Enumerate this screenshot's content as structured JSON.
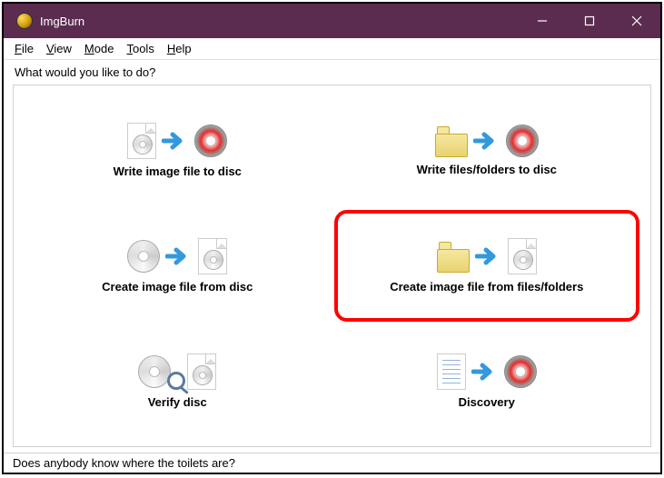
{
  "titlebar": {
    "title": "ImgBurn"
  },
  "menu": {
    "file": "File",
    "file_u": "F",
    "view": "View",
    "view_u": "V",
    "mode": "Mode",
    "mode_u": "M",
    "tools": "Tools",
    "tools_u": "T",
    "help": "Help",
    "help_u": "H"
  },
  "prompt": "What would you like to do?",
  "options": {
    "write_image": "Write image file to disc",
    "write_files": "Write files/folders to disc",
    "create_from_disc": "Create image file from disc",
    "create_from_files": "Create image file from files/folders",
    "verify": "Verify disc",
    "discovery": "Discovery"
  },
  "status": "Does anybody know where the toilets are?"
}
